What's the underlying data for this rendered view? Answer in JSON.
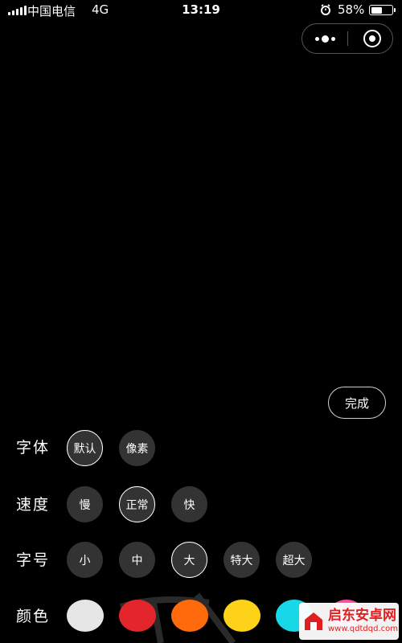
{
  "status_bar": {
    "carrier": "中国电信",
    "network": "4G",
    "time": "13:19",
    "battery": "58%",
    "battery_level": 0.58,
    "icons": [
      "signal-icon",
      "alarm-icon",
      "battery-icon"
    ]
  },
  "capsule": {
    "icons": [
      "more-icon",
      "close-target-icon"
    ]
  },
  "done_button": {
    "label": "完成"
  },
  "font_row": {
    "label": "字体",
    "options": [
      {
        "label": "默认",
        "selected": true
      },
      {
        "label": "像素",
        "selected": false
      }
    ]
  },
  "speed_row": {
    "label": "速度",
    "options": [
      {
        "label": "慢",
        "selected": false
      },
      {
        "label": "正常",
        "selected": true
      },
      {
        "label": "快",
        "selected": false
      }
    ]
  },
  "size_row": {
    "label": "字号",
    "options": [
      {
        "label": "小",
        "selected": false
      },
      {
        "label": "中",
        "selected": false
      },
      {
        "label": "大",
        "selected": true
      },
      {
        "label": "特大",
        "selected": false
      },
      {
        "label": "超大",
        "selected": false
      }
    ]
  },
  "color_row": {
    "label": "颜色",
    "swatches": [
      {
        "name": "white",
        "color": "#e6e6e6"
      },
      {
        "name": "red",
        "color": "#e3262c"
      },
      {
        "name": "orange",
        "color": "#ff6a0d"
      },
      {
        "name": "yellow",
        "color": "#ffd21a"
      },
      {
        "name": "cyan",
        "color": "#16d8e6"
      },
      {
        "name": "pink",
        "color": "#ff4fa3"
      }
    ]
  },
  "watermark": {
    "title": "启东安卓网",
    "url": "www.qdtdqd.com"
  }
}
